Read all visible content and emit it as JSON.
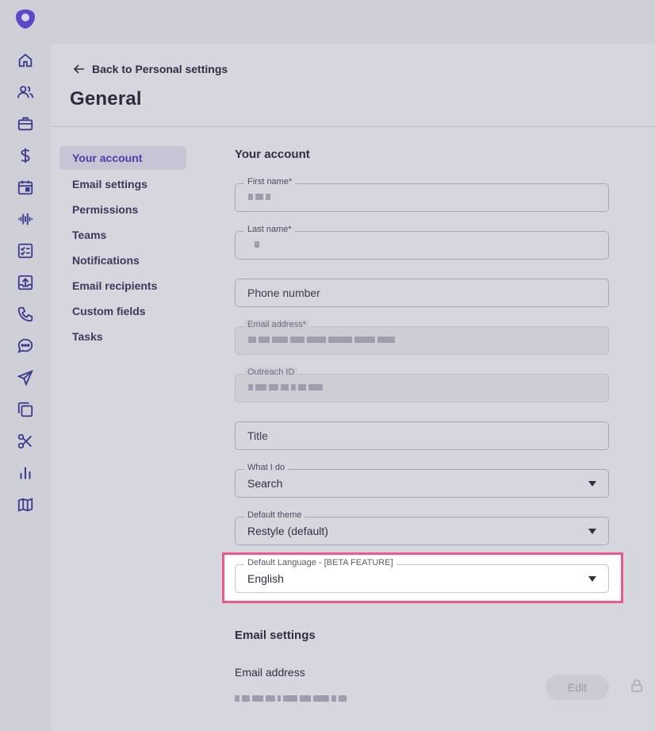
{
  "nav": {
    "back_label": "Back to Personal settings",
    "page_title": "General"
  },
  "subnav": {
    "items": [
      {
        "label": "Your account",
        "active": true
      },
      {
        "label": "Email settings"
      },
      {
        "label": "Permissions"
      },
      {
        "label": "Teams"
      },
      {
        "label": "Notifications"
      },
      {
        "label": "Email recipients"
      },
      {
        "label": "Custom fields"
      },
      {
        "label": "Tasks"
      }
    ]
  },
  "account": {
    "section_title": "Your account",
    "first_name_label": "First name*",
    "last_name_label": "Last name*",
    "phone_placeholder": "Phone number",
    "email_label": "Email address*",
    "outreach_id_label": "Outreach ID",
    "title_placeholder": "Title",
    "what_i_do_label": "What I do",
    "what_i_do_value": "Search",
    "theme_label": "Default theme",
    "theme_value": "Restyle (default)",
    "language_label": "Default Language - [BETA FEATURE]",
    "language_value": "English"
  },
  "email_settings": {
    "section_title": "Email settings",
    "email_address_label": "Email address",
    "edit_label": "Edit"
  },
  "colors": {
    "accent": "#4b3fa8",
    "highlight": "#f0588a"
  },
  "icons": [
    "logo-icon",
    "home-icon",
    "people-icon",
    "briefcase-icon",
    "dollar-icon",
    "calendar-icon",
    "waveform-icon",
    "tasks-icon",
    "upload-icon",
    "phone-icon",
    "chat-icon",
    "send-icon",
    "copy-icon",
    "scissors-icon",
    "bar-chart-icon",
    "map-icon"
  ]
}
